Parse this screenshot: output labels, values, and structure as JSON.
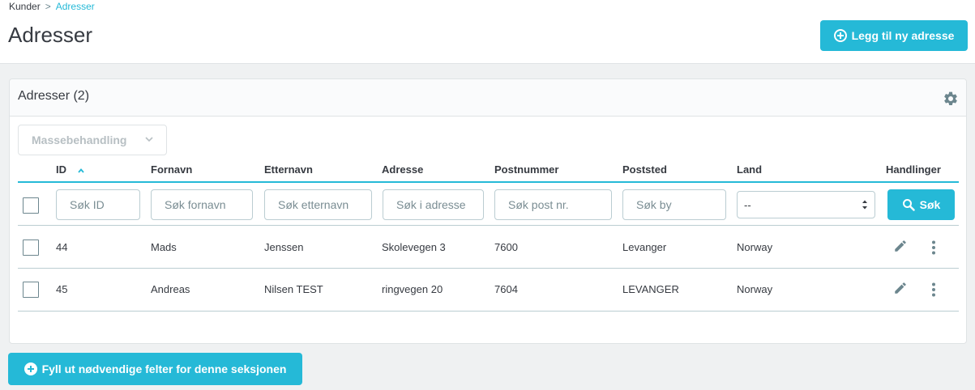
{
  "breadcrumb": {
    "parent": "Kunder",
    "separator": ">",
    "current": "Adresser"
  },
  "page_title": "Adresser",
  "add_button_label": "Legg til ny adresse",
  "card": {
    "title": "Adresser (2)"
  },
  "bulk_actions_label": "Massebehandling",
  "columns": {
    "id": "ID",
    "firstname": "Fornavn",
    "lastname": "Etternavn",
    "address": "Adresse",
    "postcode": "Postnummer",
    "city": "Poststed",
    "country": "Land",
    "actions": "Handlinger"
  },
  "filters": {
    "id_placeholder": "Søk ID",
    "firstname_placeholder": "Søk fornavn",
    "lastname_placeholder": "Søk etternavn",
    "address_placeholder": "Søk i adresse",
    "postcode_placeholder": "Søk post nr.",
    "city_placeholder": "Søk by",
    "country_selected": "--",
    "search_label": "Søk"
  },
  "rows": [
    {
      "id": "44",
      "firstname": "Mads",
      "lastname": "Jenssen",
      "address": "Skolevegen 3",
      "postcode": "7600",
      "city": "Levanger",
      "country": "Norway"
    },
    {
      "id": "45",
      "firstname": "Andreas",
      "lastname": "Nilsen TEST",
      "address": "ringvegen 20",
      "postcode": "7604",
      "city": "LEVANGER",
      "country": "Norway"
    }
  ],
  "fill_required_button_label": "Fyll ut nødvendige felter for denne seksjonen",
  "colors": {
    "accent": "#25b9d7",
    "text": "#363a41",
    "border": "#bbcdd2"
  }
}
